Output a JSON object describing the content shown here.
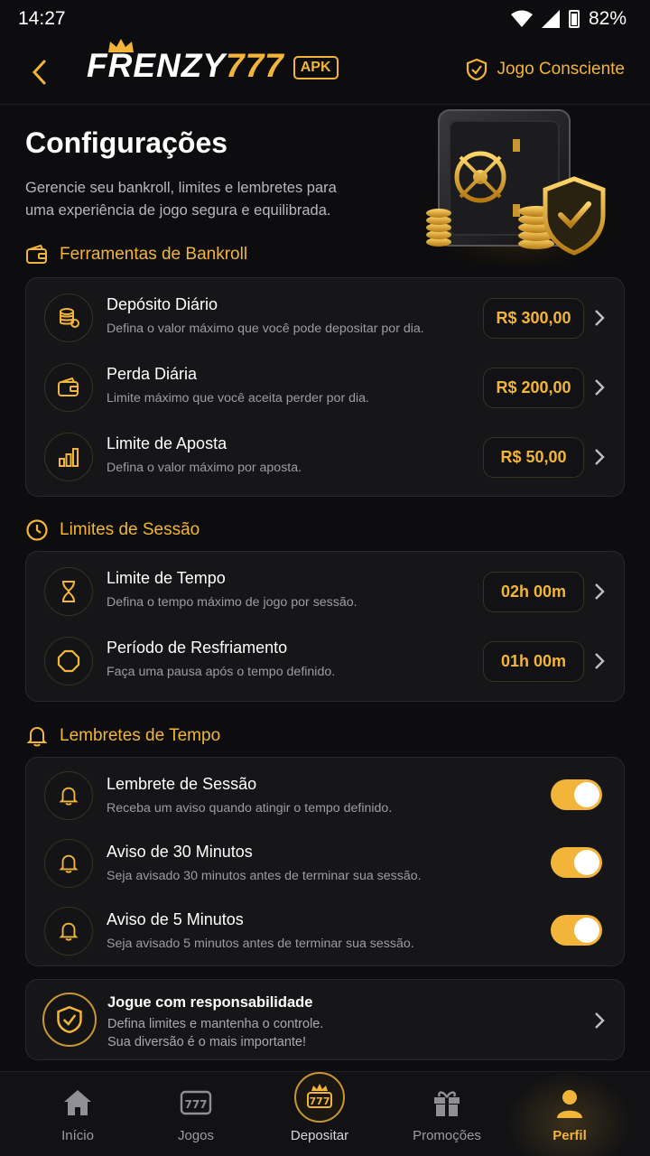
{
  "status_bar": {
    "time": "14:27",
    "battery": "82%"
  },
  "header": {
    "logo_text": "FRENZY",
    "logo_number": "777",
    "apk_badge": "APK",
    "conscious_label": "Jogo Consciente"
  },
  "hero": {
    "title": "Configurações",
    "subtitle": "Gerencie seu bankroll, limites e lembretes para uma experiência de jogo segura e equilibrada."
  },
  "bankroll": {
    "title": "Ferramentas de Bankroll",
    "items": [
      {
        "title": "Depósito Diário",
        "desc": "Defina o valor máximo que você pode depositar por dia.",
        "value": "R$ 300,00",
        "icon": "coins-icon"
      },
      {
        "title": "Perda Diária",
        "desc": "Limite máximo que você aceita perder por dia.",
        "value": "R$ 200,00",
        "icon": "wallet-icon"
      },
      {
        "title": "Limite de Aposta",
        "desc": "Defina o valor máximo por aposta.",
        "value": "R$ 50,00",
        "icon": "bar-chart-icon"
      }
    ]
  },
  "session": {
    "title": "Limites de Sessão",
    "items": [
      {
        "title": "Limite de Tempo",
        "desc": "Defina o tempo máximo de jogo por sessão.",
        "value": "02h 00m",
        "icon": "hourglass-icon"
      },
      {
        "title": "Período de Resfriamento",
        "desc": "Faça uma pausa após o tempo definido.",
        "value": "01h 00m",
        "icon": "octagon-icon"
      }
    ]
  },
  "reminders": {
    "title": "Lembretes de Tempo",
    "items": [
      {
        "title": "Lembrete de Sessão",
        "desc": "Receba um aviso quando atingir o tempo definido.",
        "enabled": true
      },
      {
        "title": "Aviso de 30 Minutos",
        "desc": "Seja avisado 30 minutos antes de terminar sua sessão.",
        "enabled": true
      },
      {
        "title": "Aviso de 5 Minutos",
        "desc": "Seja avisado 5 minutos antes de terminar sua sessão.",
        "enabled": true
      }
    ]
  },
  "responsibility": {
    "title": "Jogue com responsabilidade",
    "line1": "Defina limites e mantenha o controle.",
    "line2": "Sua diversão é o mais importante!"
  },
  "bottom_nav": {
    "items": [
      {
        "label": "Início",
        "icon": "home-icon"
      },
      {
        "label": "Jogos",
        "icon": "slot-machine-icon"
      },
      {
        "label": "Depositar",
        "icon": "deposit-777-icon"
      },
      {
        "label": "Promoções",
        "icon": "gift-icon"
      },
      {
        "label": "Perfil",
        "icon": "user-icon",
        "active": true
      }
    ]
  },
  "colors": {
    "accent": "#f2b53a",
    "background": "#0d0d0f",
    "card": "#161618"
  }
}
